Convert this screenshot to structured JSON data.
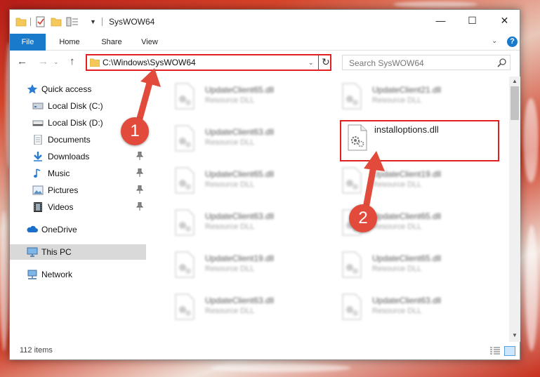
{
  "window": {
    "title": "SysWOW64",
    "controls": {
      "minimize": "—",
      "maximize": "☐",
      "close": "✕"
    }
  },
  "ribbon": {
    "tabs": [
      "File",
      "Home",
      "Share",
      "View"
    ],
    "help": "?"
  },
  "navigation": {
    "address_path": "C:\\Windows\\SysWOW64",
    "search_placeholder": "Search SysWOW64"
  },
  "sidebar": {
    "items": [
      {
        "label": "Quick access",
        "icon": "star-icon"
      },
      {
        "label": "Local Disk (C:)",
        "icon": "drive-icon"
      },
      {
        "label": "Local Disk (D:)",
        "icon": "drive-icon"
      },
      {
        "label": "Documents",
        "icon": "documents-icon"
      },
      {
        "label": "Downloads",
        "icon": "download-icon"
      },
      {
        "label": "Music",
        "icon": "music-icon"
      },
      {
        "label": "Pictures",
        "icon": "pictures-icon"
      },
      {
        "label": "Videos",
        "icon": "videos-icon"
      },
      {
        "label": "OneDrive",
        "icon": "cloud-icon"
      },
      {
        "label": "This PC",
        "icon": "computer-icon"
      },
      {
        "label": "Network",
        "icon": "network-icon"
      }
    ]
  },
  "files": [
    {
      "name": "UpdateClient65.dll",
      "type": "Resource DLL"
    },
    {
      "name": "UpdateClient21.dll",
      "type": "Resource DLL"
    },
    {
      "name": "UpdateClient63.dll",
      "type": "Resource DLL"
    },
    {
      "name": "installoptions.dll",
      "type": ""
    },
    {
      "name": "UpdateClient65.dll",
      "type": "Resource DLL"
    },
    {
      "name": "UpdateClient19.dll",
      "type": "Resource DLL"
    },
    {
      "name": "UpdateClient63.dll",
      "type": "Resource DLL"
    },
    {
      "name": "UpdateClient65.dll",
      "type": "Resource DLL"
    },
    {
      "name": "UpdateClient19.dll",
      "type": "Resource DLL"
    },
    {
      "name": "UpdateClient65.dll",
      "type": "Resource DLL"
    },
    {
      "name": "UpdateClient63.dll",
      "type": "Resource DLL"
    },
    {
      "name": "UpdateClient63.dll",
      "type": "Resource DLL"
    }
  ],
  "status": {
    "item_count": "112 items"
  },
  "annotations": {
    "step1": "1",
    "step2": "2"
  },
  "colors": {
    "accent": "#1979ca",
    "highlight": "#e02020",
    "annotation": "#e24b3c"
  }
}
